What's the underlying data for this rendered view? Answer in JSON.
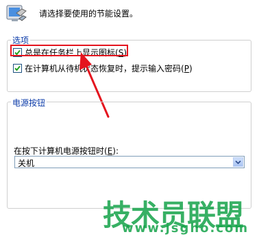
{
  "header": {
    "text": "请选择要使用的节能设置。"
  },
  "options_group": {
    "legend": "选项",
    "show_icon": {
      "label": "总是在任务栏上显示图标(",
      "key": "S",
      "suffix": ")",
      "checked": true
    },
    "prompt_password": {
      "label": "在计算机从待机状态恢复时，提示输入密码(",
      "key": "P",
      "suffix": ")",
      "checked": true
    }
  },
  "power_group": {
    "legend": "电源按钮",
    "select_label_prefix": "在按下计算机电源按钮时(",
    "select_label_key": "E",
    "select_label_suffix": "):",
    "select_value": "关机"
  },
  "watermark": {
    "title": "技术员联盟",
    "url": "www.jsgho.com"
  },
  "colors": {
    "legend": "#0a3aa8",
    "highlight": "#e4141e",
    "watermark": "#15a34a"
  }
}
